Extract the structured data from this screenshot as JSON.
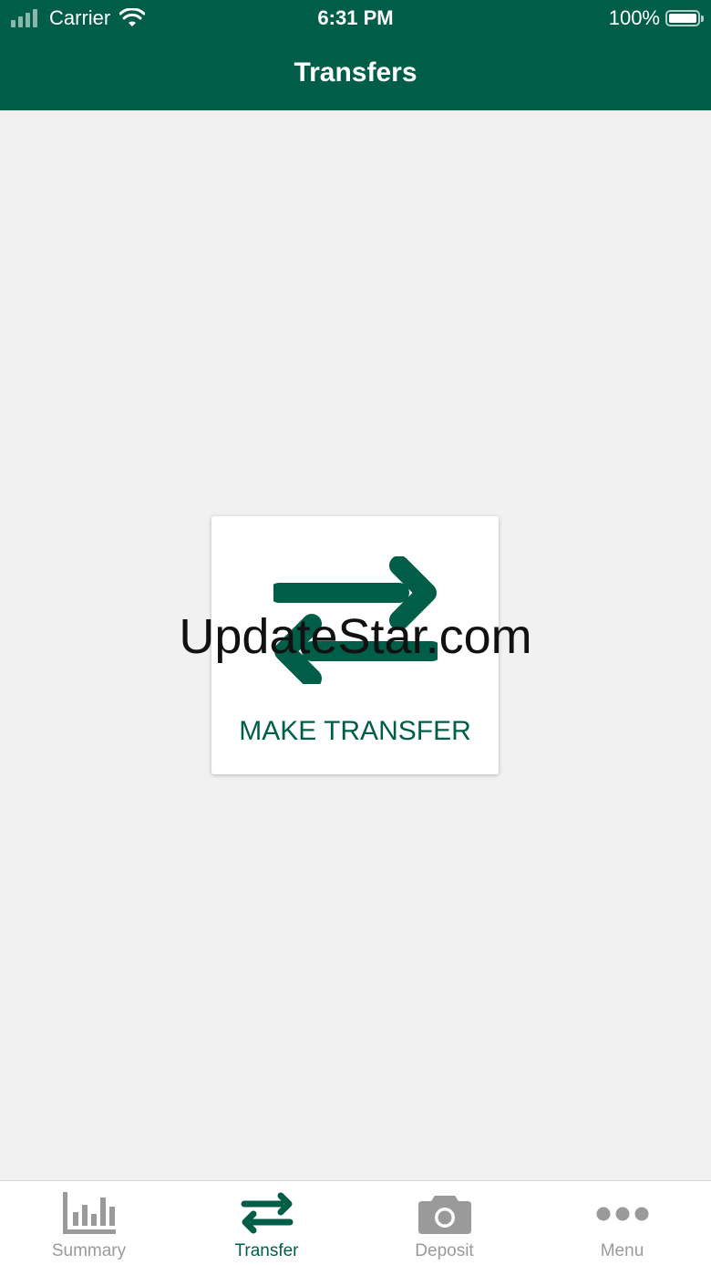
{
  "status_bar": {
    "carrier": "Carrier",
    "time": "6:31 PM",
    "battery": "100%"
  },
  "header": {
    "title": "Transfers"
  },
  "main": {
    "make_transfer_label": "MAKE TRANSFER"
  },
  "watermark": "UpdateStar.com",
  "tab_bar": {
    "tabs": [
      {
        "label": "Summary",
        "icon": "bar-chart-icon",
        "active": false
      },
      {
        "label": "Transfer",
        "icon": "transfer-arrows-icon",
        "active": true
      },
      {
        "label": "Deposit",
        "icon": "camera-icon",
        "active": false
      },
      {
        "label": "Menu",
        "icon": "more-dots-icon",
        "active": false
      }
    ]
  },
  "colors": {
    "brand": "#005e48",
    "background": "#f1f1f1",
    "inactive": "#9a9a9a"
  }
}
